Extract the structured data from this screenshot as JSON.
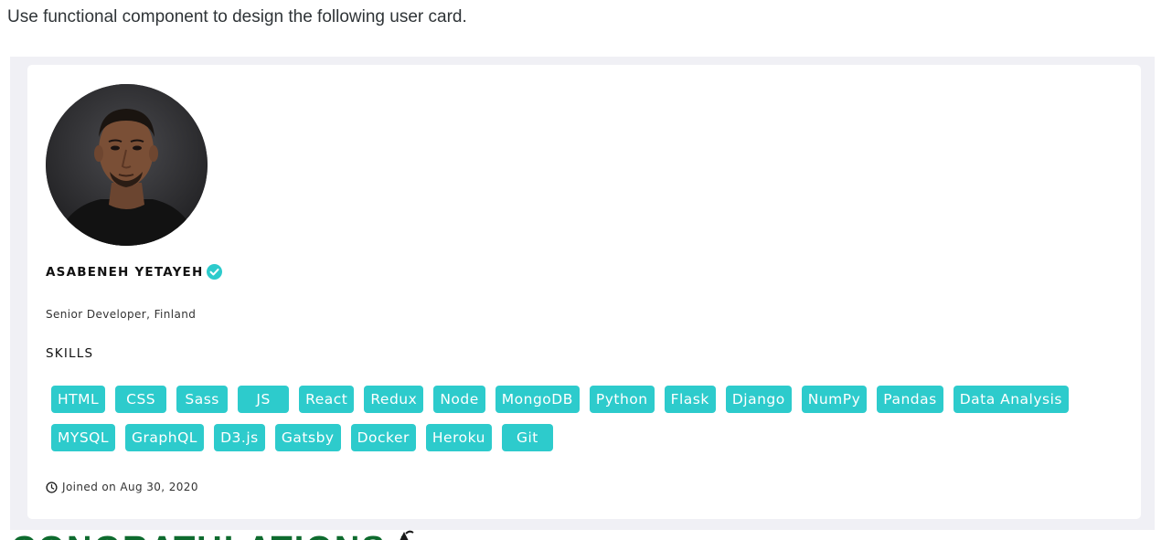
{
  "instruction": "Use functional component to design the following user card.",
  "card": {
    "name": "ASABENEH YETAYEH",
    "verified_icon": "check-circle-icon",
    "role": "Senior Developer, Finland",
    "skills_title": "SKILLS",
    "skills": [
      "HTML",
      "CSS",
      "Sass",
      "JS",
      "React",
      "Redux",
      "Node",
      "MongoDB",
      "Python",
      "Flask",
      "Django",
      "NumPy",
      "Pandas",
      "Data Analysis",
      "MYSQL",
      "GraphQL",
      "D3.js",
      "Gatsby",
      "Docker",
      "Heroku",
      "Git"
    ],
    "joined": "Joined on Aug 30, 2020",
    "joined_icon": "clock-icon"
  },
  "footer_heading": "CONGRATULATIONS !",
  "colors": {
    "skill_bg": "#2dcbcc",
    "verified": "#2dcbcc",
    "panel_bg": "#f0f0f5",
    "heading": "#0e6b2e"
  }
}
